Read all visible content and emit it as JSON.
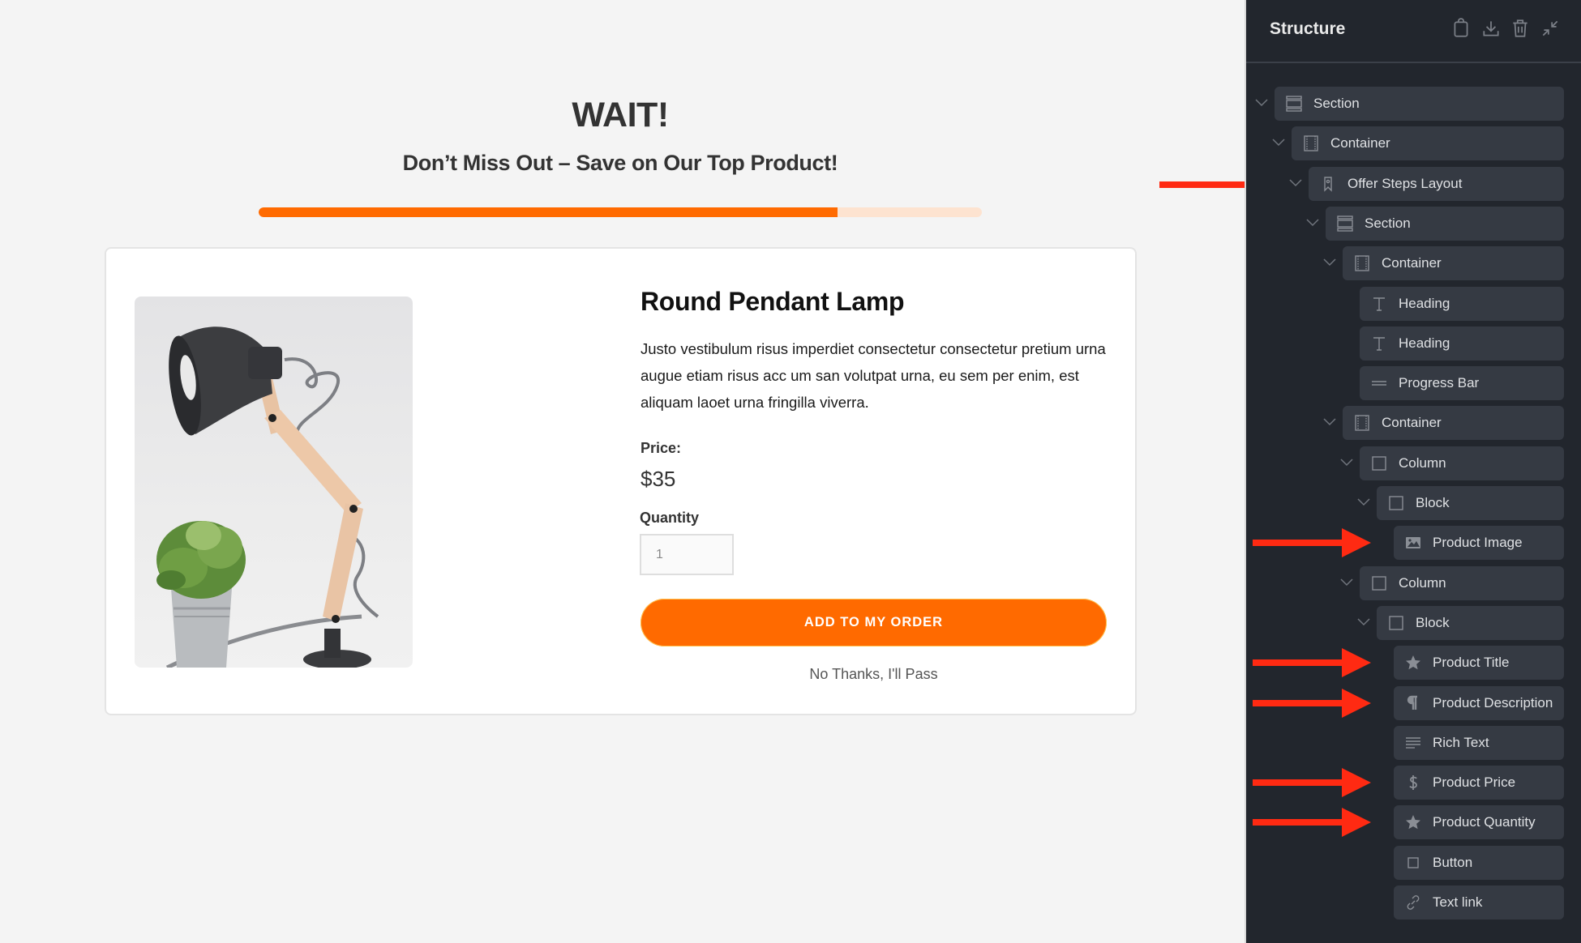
{
  "canvas": {
    "heading": "WAIT!",
    "subheading": "Don’t Miss Out – Save on Our Top Product!",
    "progress": {
      "percent": 80,
      "fill_color": "#ff6a00",
      "track_color": "#fde3d0"
    },
    "product": {
      "image_alt": "desk-lamp-with-potted-plant",
      "title": "Round Pendant Lamp",
      "description": "Justo vestibulum risus imperdiet consectetur consectetur pretium urna augue etiam risus acc um san volutpat urna, eu sem per enim, est aliquam laoet urna fringilla viverra.",
      "price_label": "Price:",
      "price": "$35",
      "quantity_label": "Quantity",
      "quantity_value": "1",
      "add_button": "ADD TO MY ORDER",
      "decline_link": "No Thanks, I'll Pass"
    },
    "accent_color": "#ff6a00"
  },
  "annotation_arrows": {
    "color": "#ff2a12",
    "targets": [
      "Offer Steps Layout",
      "Product Image",
      "Product Title",
      "Product Description",
      "Product Price",
      "Product Quantity"
    ]
  },
  "structure_panel": {
    "title": "Structure",
    "header_actions": [
      {
        "name": "clipboard-icon",
        "label": "Paste"
      },
      {
        "name": "download-icon",
        "label": "Download"
      },
      {
        "name": "trash-icon",
        "label": "Delete"
      },
      {
        "name": "collapse-icon",
        "label": "Collapse"
      }
    ],
    "tree": [
      {
        "label": "Section",
        "depth": 0,
        "icon": "section",
        "expandable": true
      },
      {
        "label": "Container",
        "depth": 1,
        "icon": "container",
        "expandable": true
      },
      {
        "label": "Offer Steps Layout",
        "depth": 2,
        "icon": "bookmark",
        "expandable": true
      },
      {
        "label": "Section",
        "depth": 3,
        "icon": "section",
        "expandable": true
      },
      {
        "label": "Container",
        "depth": 4,
        "icon": "container",
        "expandable": true
      },
      {
        "label": "Heading",
        "depth": 5,
        "icon": "heading",
        "expandable": false
      },
      {
        "label": "Heading",
        "depth": 5,
        "icon": "heading",
        "expandable": false
      },
      {
        "label": "Progress Bar",
        "depth": 5,
        "icon": "progress",
        "expandable": false
      },
      {
        "label": "Container",
        "depth": 4,
        "icon": "container",
        "expandable": true
      },
      {
        "label": "Column",
        "depth": 5,
        "icon": "box",
        "expandable": true
      },
      {
        "label": "Block",
        "depth": 6,
        "icon": "box",
        "expandable": true
      },
      {
        "label": "Product Image",
        "depth": 7,
        "icon": "image",
        "expandable": false
      },
      {
        "label": "Column",
        "depth": 5,
        "icon": "box",
        "expandable": true
      },
      {
        "label": "Block",
        "depth": 6,
        "icon": "box",
        "expandable": true
      },
      {
        "label": "Product Title",
        "depth": 7,
        "icon": "star",
        "expandable": false
      },
      {
        "label": "Product Description",
        "depth": 7,
        "icon": "pilcrow",
        "expandable": false
      },
      {
        "label": "Rich Text",
        "depth": 7,
        "icon": "richtext",
        "expandable": false
      },
      {
        "label": "Product Price",
        "depth": 7,
        "icon": "dollar",
        "expandable": false
      },
      {
        "label": "Product Quantity",
        "depth": 7,
        "icon": "star",
        "expandable": false
      },
      {
        "label": "Button",
        "depth": 7,
        "icon": "button",
        "expandable": false
      },
      {
        "label": "Text link",
        "depth": 7,
        "icon": "link",
        "expandable": false
      }
    ]
  }
}
